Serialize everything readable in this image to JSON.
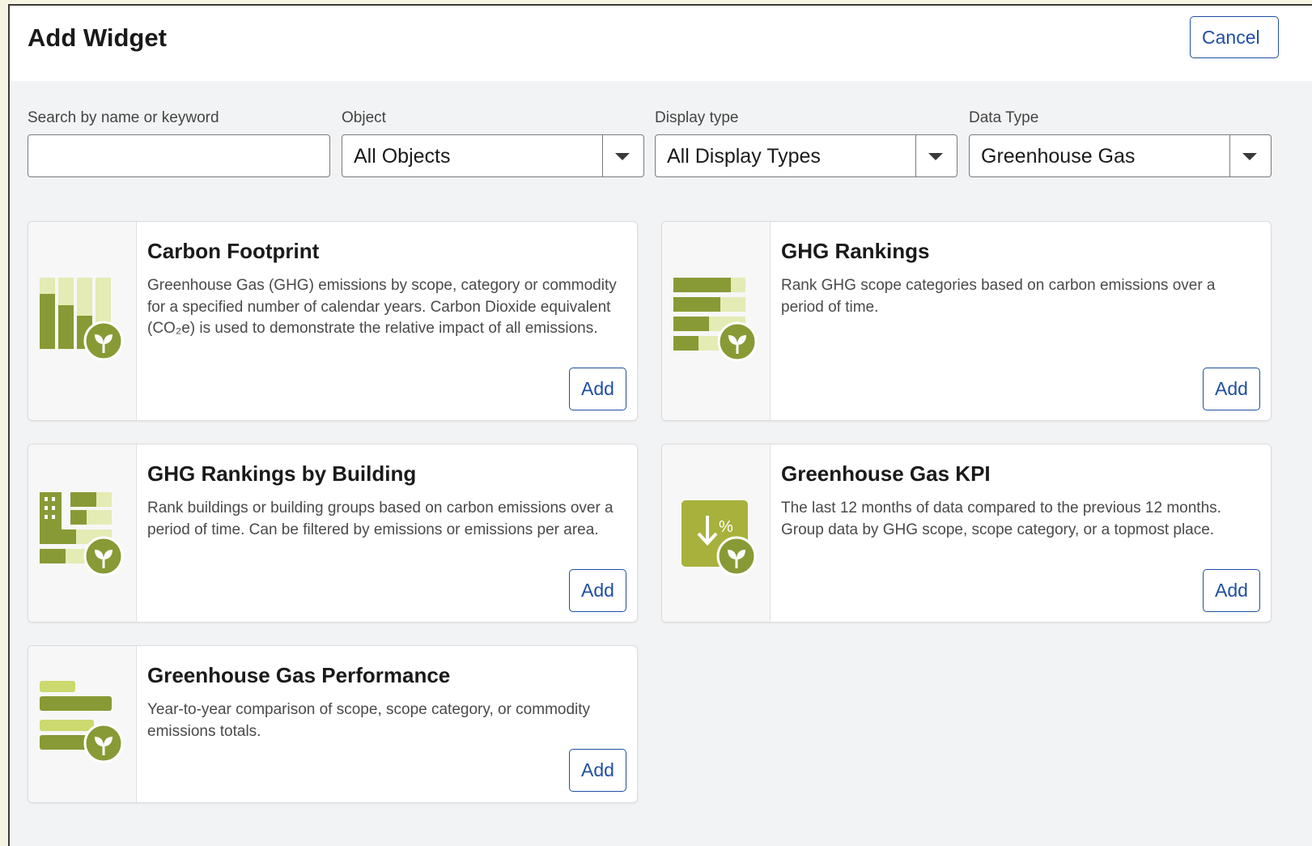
{
  "header": {
    "title": "Add Widget",
    "cancel_label": "Cancel"
  },
  "filters": {
    "search_label": "Search by name or keyword",
    "search_value": "",
    "object_label": "Object",
    "object_value": "All Objects",
    "display_label": "Display type",
    "display_value": "All Display Types",
    "datatype_label": "Data Type",
    "datatype_value": "Greenhouse Gas"
  },
  "widgets": [
    {
      "title": "Carbon Footprint",
      "description": "Greenhouse Gas (GHG) emissions by scope, category or commodity for a specified number of calendar years. Carbon Dioxide equivalent (CO₂e) is used to demonstrate the relative impact of all emissions.",
      "add_label": "Add",
      "icon": "stacked-bar-chart-leaf-icon"
    },
    {
      "title": "GHG Rankings",
      "description": "Rank GHG scope categories based on carbon emissions over a period of time.",
      "add_label": "Add",
      "icon": "ranking-bars-leaf-icon"
    },
    {
      "title": "GHG Rankings by Building",
      "description": "Rank buildings or building groups based on carbon emissions over a period of time. Can be filtered by emissions or emissions per area.",
      "add_label": "Add",
      "icon": "building-ranking-leaf-icon"
    },
    {
      "title": "Greenhouse Gas KPI",
      "description": "The last 12 months of data compared to the previous 12 months. Group data by GHG scope, scope category, or a topmost place.",
      "add_label": "Add",
      "icon": "kpi-percent-leaf-icon"
    },
    {
      "title": "Greenhouse Gas Performance",
      "description": "Year-to-year comparison of scope, scope category, or commodity emissions totals.",
      "add_label": "Add",
      "icon": "performance-bars-leaf-icon"
    }
  ],
  "colors": {
    "accent_blue": "#1f4fa3",
    "olive_dark": "#889a35",
    "olive_light": "#e5ebb5",
    "olive_mid": "#cbd96e"
  }
}
